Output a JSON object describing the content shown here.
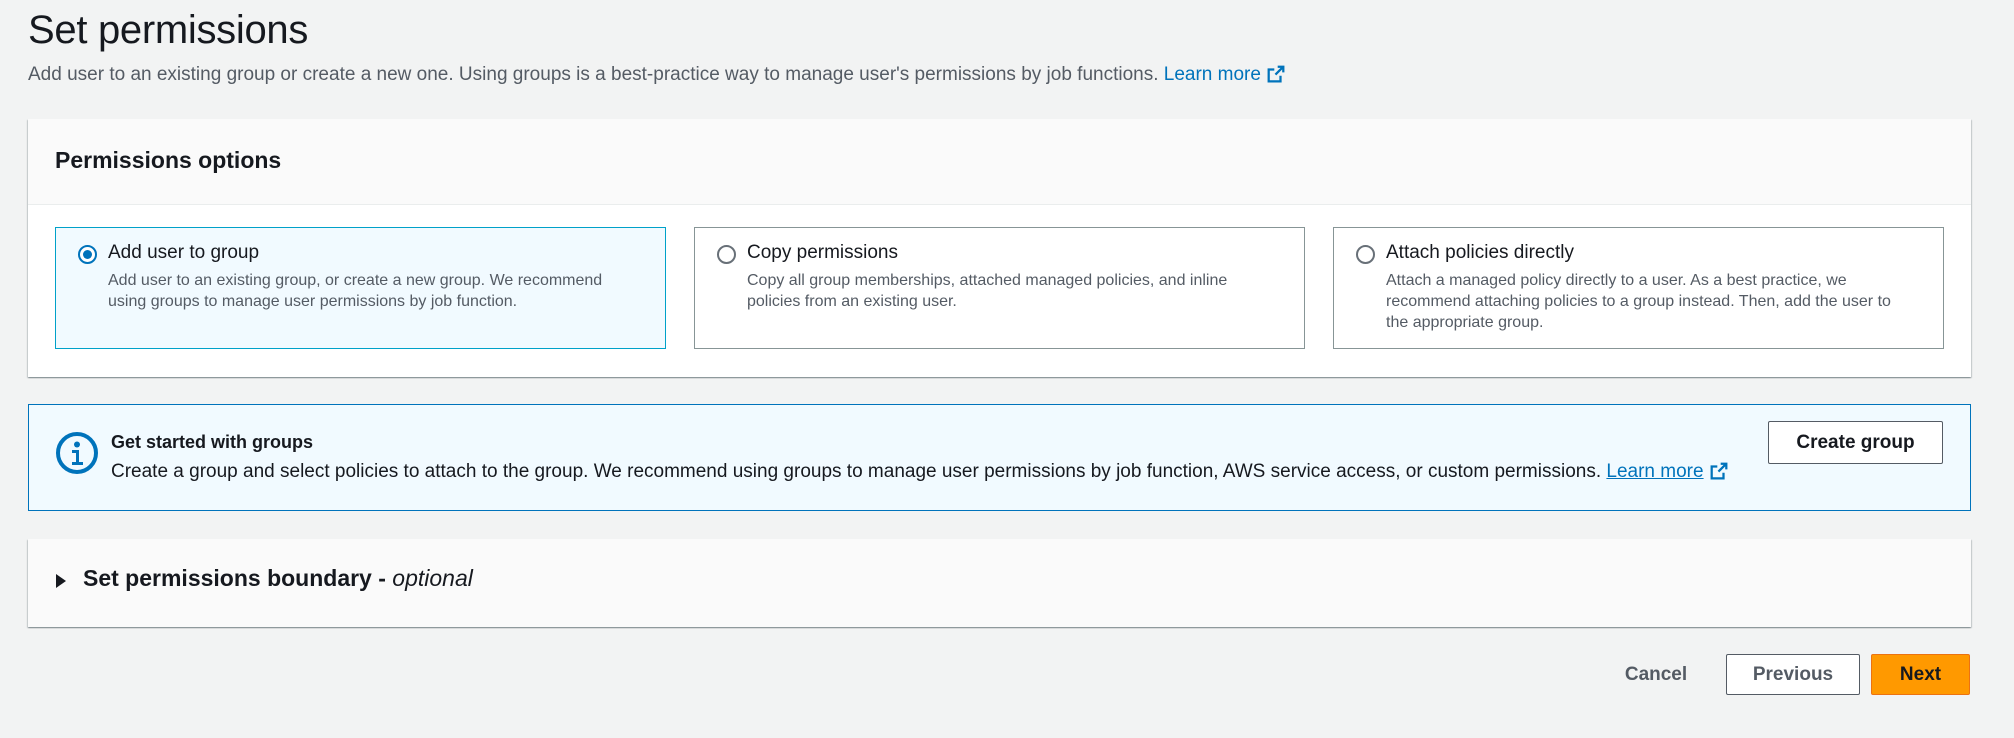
{
  "header": {
    "title": "Set permissions",
    "description": "Add user to an existing group or create a new one. Using groups is a best-practice way to manage user's permissions by job functions.",
    "learn_more": "Learn more"
  },
  "permissions_options": {
    "title": "Permissions options",
    "selected": "Add user to group",
    "options": [
      {
        "label": "Add user to group",
        "description": "Add user to an existing group, or create a new group. We recommend using groups to manage user permissions by job function."
      },
      {
        "label": "Copy permissions",
        "description": "Copy all group memberships, attached managed policies, and inline policies from an existing user."
      },
      {
        "label": "Attach policies directly",
        "description": "Attach a managed policy directly to a user. As a best practice, we recommend attaching policies to a group instead. Then, add the user to the appropriate group."
      }
    ]
  },
  "info_alert": {
    "title": "Get started with groups",
    "text": "Create a group and select policies to attach to the group. We recommend using groups to manage user permissions by job function, AWS service access, or custom permissions.",
    "learn_more": "Learn more",
    "button_label": "Create group"
  },
  "boundary": {
    "title": "Set permissions boundary - ",
    "optional": "optional",
    "expanded": false
  },
  "footer": {
    "cancel": "Cancel",
    "previous": "Previous",
    "next": "Next"
  },
  "colors": {
    "primary": "#ff9900",
    "link": "#0073bb",
    "selected_tile_bg": "#f1faff",
    "page_bg": "#f2f3f3"
  }
}
